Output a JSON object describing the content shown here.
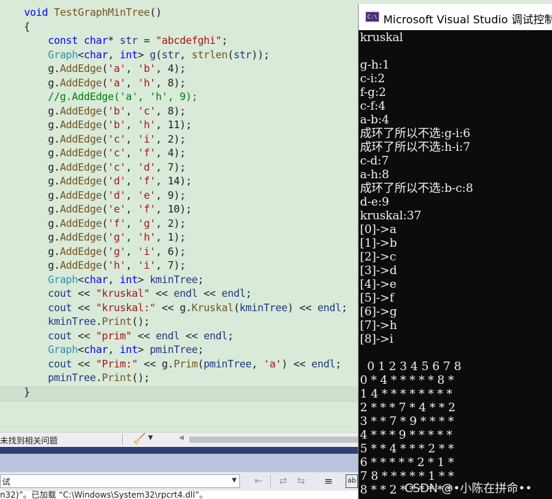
{
  "editor": {
    "lines": [
      [
        [
          "    ",
          "pl"
        ],
        [
          "void",
          "kw"
        ],
        [
          " ",
          "pl"
        ],
        [
          "TestGraphMinTree",
          "fn"
        ],
        [
          "()",
          "pl"
        ]
      ],
      [
        [
          "    {",
          "pl"
        ]
      ],
      [
        [
          "        ",
          "pl"
        ],
        [
          "const",
          "kw"
        ],
        [
          " ",
          "pl"
        ],
        [
          "char",
          "kw"
        ],
        [
          "* ",
          "pl"
        ],
        [
          "str",
          "id"
        ],
        [
          " = ",
          "pl"
        ],
        [
          "\"abcdefghi\"",
          "str"
        ],
        [
          ";",
          "pl"
        ]
      ],
      [
        [
          "        ",
          "pl"
        ],
        [
          "Graph",
          "ty"
        ],
        [
          "<",
          "pl"
        ],
        [
          "char",
          "kw"
        ],
        [
          ", ",
          "pl"
        ],
        [
          "int",
          "kw"
        ],
        [
          "> ",
          "pl"
        ],
        [
          "g",
          "id"
        ],
        [
          "(",
          "pl"
        ],
        [
          "str",
          "id"
        ],
        [
          ", ",
          "pl"
        ],
        [
          "strlen",
          "fn"
        ],
        [
          "(",
          "pl"
        ],
        [
          "str",
          "id"
        ],
        [
          "));",
          "pl"
        ]
      ],
      [
        [
          "        g.",
          "pl"
        ],
        [
          "AddEdge",
          "fn"
        ],
        [
          "(",
          "pl"
        ],
        [
          "'a'",
          "str"
        ],
        [
          ", ",
          "pl"
        ],
        [
          "'b'",
          "str"
        ],
        [
          ", 4);",
          "pl"
        ]
      ],
      [
        [
          "        g.",
          "pl"
        ],
        [
          "AddEdge",
          "fn"
        ],
        [
          "(",
          "pl"
        ],
        [
          "'a'",
          "str"
        ],
        [
          ", ",
          "pl"
        ],
        [
          "'h'",
          "str"
        ],
        [
          ", 8);",
          "pl"
        ]
      ],
      [
        [
          "        //g.AddEdge('a', 'h', 9);",
          "cm"
        ]
      ],
      [
        [
          "        g.",
          "pl"
        ],
        [
          "AddEdge",
          "fn"
        ],
        [
          "(",
          "pl"
        ],
        [
          "'b'",
          "str"
        ],
        [
          ", ",
          "pl"
        ],
        [
          "'c'",
          "str"
        ],
        [
          ", 8);",
          "pl"
        ]
      ],
      [
        [
          "        g.",
          "pl"
        ],
        [
          "AddEdge",
          "fn"
        ],
        [
          "(",
          "pl"
        ],
        [
          "'b'",
          "str"
        ],
        [
          ", ",
          "pl"
        ],
        [
          "'h'",
          "str"
        ],
        [
          ", 11);",
          "pl"
        ]
      ],
      [
        [
          "        g.",
          "pl"
        ],
        [
          "AddEdge",
          "fn"
        ],
        [
          "(",
          "pl"
        ],
        [
          "'c'",
          "str"
        ],
        [
          ", ",
          "pl"
        ],
        [
          "'i'",
          "str"
        ],
        [
          ", 2);",
          "pl"
        ]
      ],
      [
        [
          "        g.",
          "pl"
        ],
        [
          "AddEdge",
          "fn"
        ],
        [
          "(",
          "pl"
        ],
        [
          "'c'",
          "str"
        ],
        [
          ", ",
          "pl"
        ],
        [
          "'f'",
          "str"
        ],
        [
          ", 4);",
          "pl"
        ]
      ],
      [
        [
          "        g.",
          "pl"
        ],
        [
          "AddEdge",
          "fn"
        ],
        [
          "(",
          "pl"
        ],
        [
          "'c'",
          "str"
        ],
        [
          ", ",
          "pl"
        ],
        [
          "'d'",
          "str"
        ],
        [
          ", 7);",
          "pl"
        ]
      ],
      [
        [
          "        g.",
          "pl"
        ],
        [
          "AddEdge",
          "fn"
        ],
        [
          "(",
          "pl"
        ],
        [
          "'d'",
          "str"
        ],
        [
          ", ",
          "pl"
        ],
        [
          "'f'",
          "str"
        ],
        [
          ", 14);",
          "pl"
        ]
      ],
      [
        [
          "        g.",
          "pl"
        ],
        [
          "AddEdge",
          "fn"
        ],
        [
          "(",
          "pl"
        ],
        [
          "'d'",
          "str"
        ],
        [
          ", ",
          "pl"
        ],
        [
          "'e'",
          "str"
        ],
        [
          ", 9);",
          "pl"
        ]
      ],
      [
        [
          "        g.",
          "pl"
        ],
        [
          "AddEdge",
          "fn"
        ],
        [
          "(",
          "pl"
        ],
        [
          "'e'",
          "str"
        ],
        [
          ", ",
          "pl"
        ],
        [
          "'f'",
          "str"
        ],
        [
          ", 10);",
          "pl"
        ]
      ],
      [
        [
          "        g.",
          "pl"
        ],
        [
          "AddEdge",
          "fn"
        ],
        [
          "(",
          "pl"
        ],
        [
          "'f'",
          "str"
        ],
        [
          ", ",
          "pl"
        ],
        [
          "'g'",
          "str"
        ],
        [
          ", 2);",
          "pl"
        ]
      ],
      [
        [
          "        g.",
          "pl"
        ],
        [
          "AddEdge",
          "fn"
        ],
        [
          "(",
          "pl"
        ],
        [
          "'g'",
          "str"
        ],
        [
          ", ",
          "pl"
        ],
        [
          "'h'",
          "str"
        ],
        [
          ", 1);",
          "pl"
        ]
      ],
      [
        [
          "        g.",
          "pl"
        ],
        [
          "AddEdge",
          "fn"
        ],
        [
          "(",
          "pl"
        ],
        [
          "'g'",
          "str"
        ],
        [
          ", ",
          "pl"
        ],
        [
          "'i'",
          "str"
        ],
        [
          ", 6);",
          "pl"
        ]
      ],
      [
        [
          "        g.",
          "pl"
        ],
        [
          "AddEdge",
          "fn"
        ],
        [
          "(",
          "pl"
        ],
        [
          "'h'",
          "str"
        ],
        [
          ", ",
          "pl"
        ],
        [
          "'i'",
          "str"
        ],
        [
          ", 7);",
          "pl"
        ]
      ],
      [
        [
          "        ",
          "pl"
        ],
        [
          "Graph",
          "ty"
        ],
        [
          "<",
          "pl"
        ],
        [
          "char",
          "kw"
        ],
        [
          ", ",
          "pl"
        ],
        [
          "int",
          "kw"
        ],
        [
          "> ",
          "pl"
        ],
        [
          "kminTree",
          "id"
        ],
        [
          ";",
          "pl"
        ]
      ],
      [
        [
          "        ",
          "pl"
        ],
        [
          "cout",
          "id"
        ],
        [
          " << ",
          "pl"
        ],
        [
          "\"kruskal\"",
          "str"
        ],
        [
          " << ",
          "pl"
        ],
        [
          "endl",
          "id"
        ],
        [
          " << ",
          "pl"
        ],
        [
          "endl",
          "id"
        ],
        [
          ";",
          "pl"
        ]
      ],
      [
        [
          "        ",
          "pl"
        ],
        [
          "cout",
          "id"
        ],
        [
          " << ",
          "pl"
        ],
        [
          "\"kruskal:\"",
          "str"
        ],
        [
          " << g.",
          "pl"
        ],
        [
          "Kruskal",
          "fn"
        ],
        [
          "(",
          "pl"
        ],
        [
          "kminTree",
          "id"
        ],
        [
          ") << ",
          "pl"
        ],
        [
          "endl",
          "id"
        ],
        [
          ";",
          "pl"
        ]
      ],
      [
        [
          "        ",
          "pl"
        ],
        [
          "kminTree",
          "id"
        ],
        [
          ".",
          "pl"
        ],
        [
          "Print",
          "fn"
        ],
        [
          "();",
          "pl"
        ]
      ],
      [
        [
          "        ",
          "pl"
        ],
        [
          "cout",
          "id"
        ],
        [
          " << ",
          "pl"
        ],
        [
          "\"prim\"",
          "str"
        ],
        [
          " << ",
          "pl"
        ],
        [
          "endl",
          "id"
        ],
        [
          " << ",
          "pl"
        ],
        [
          "endl",
          "id"
        ],
        [
          ";",
          "pl"
        ]
      ],
      [
        [
          "        ",
          "pl"
        ],
        [
          "Graph",
          "ty"
        ],
        [
          "<",
          "pl"
        ],
        [
          "char",
          "kw"
        ],
        [
          ", ",
          "pl"
        ],
        [
          "int",
          "kw"
        ],
        [
          "> ",
          "pl"
        ],
        [
          "pminTree",
          "id"
        ],
        [
          ";",
          "pl"
        ]
      ],
      [
        [
          "        ",
          "pl"
        ],
        [
          "cout",
          "id"
        ],
        [
          " << ",
          "pl"
        ],
        [
          "\"Prim:\"",
          "str"
        ],
        [
          " << g.",
          "pl"
        ],
        [
          "Prim",
          "fn"
        ],
        [
          "(",
          "pl"
        ],
        [
          "pminTree",
          "id"
        ],
        [
          ", ",
          "pl"
        ],
        [
          "'a'",
          "str"
        ],
        [
          ") << ",
          "pl"
        ],
        [
          "endl",
          "id"
        ],
        [
          ";",
          "pl"
        ]
      ],
      [
        [
          "        ",
          "pl"
        ],
        [
          "pminTree",
          "id"
        ],
        [
          ".",
          "pl"
        ],
        [
          "Print",
          "fn"
        ],
        [
          "();",
          "pl"
        ]
      ],
      [
        [
          "    }",
          "pl"
        ]
      ]
    ]
  },
  "statusbar": {
    "issues_text": "未找到相关问题"
  },
  "toolbar": {
    "config_text": "试"
  },
  "output_panel": {
    "text": "n32)”。已加载 “C:\\Windows\\System32\\rpcrt4.dll”。"
  },
  "console": {
    "title": "Microsoft Visual Studio 调试控制台",
    "lines": [
      "kruskal",
      "",
      "g-h:1",
      "c-i:2",
      "f-g:2",
      "c-f:4",
      "a-b:4",
      "成环了所以不选:g-i:6",
      "成环了所以不选:h-i:7",
      "c-d:7",
      "a-h:8",
      "成环了所以不选:b-c:8",
      "d-e:9",
      "kruskal:37",
      "[0]->a",
      "[1]->b",
      "[2]->c",
      "[3]->d",
      "[4]->e",
      "[5]->f",
      "[6]->g",
      "[7]->h",
      "[8]->i",
      "",
      "  0 1 2 3 4 5 6 7 8",
      "0 * 4 * * * * * 8 *",
      "1 4 * * * * * * * *",
      "2 * * * 7 * 4 * * 2",
      "3 * * 7 * 9 * * * *",
      "4 * * * 9 * * * * *",
      "5 * * 4 * * * 2 * *",
      "6 * * * * * 2 * 1 *",
      "7 8 * * * * * 1 * *",
      "8 * * 2 * * * * * *"
    ]
  },
  "watermark": {
    "text": "CSDN @•小陈在拼命••"
  },
  "colors": {
    "editor_bg": "#d9ead9",
    "console_bg": "#0c0c0c",
    "console_fg": "#f0f0f0",
    "keyword": "#0000ff",
    "type": "#2b91af",
    "string": "#a31515",
    "comment": "#008000"
  }
}
